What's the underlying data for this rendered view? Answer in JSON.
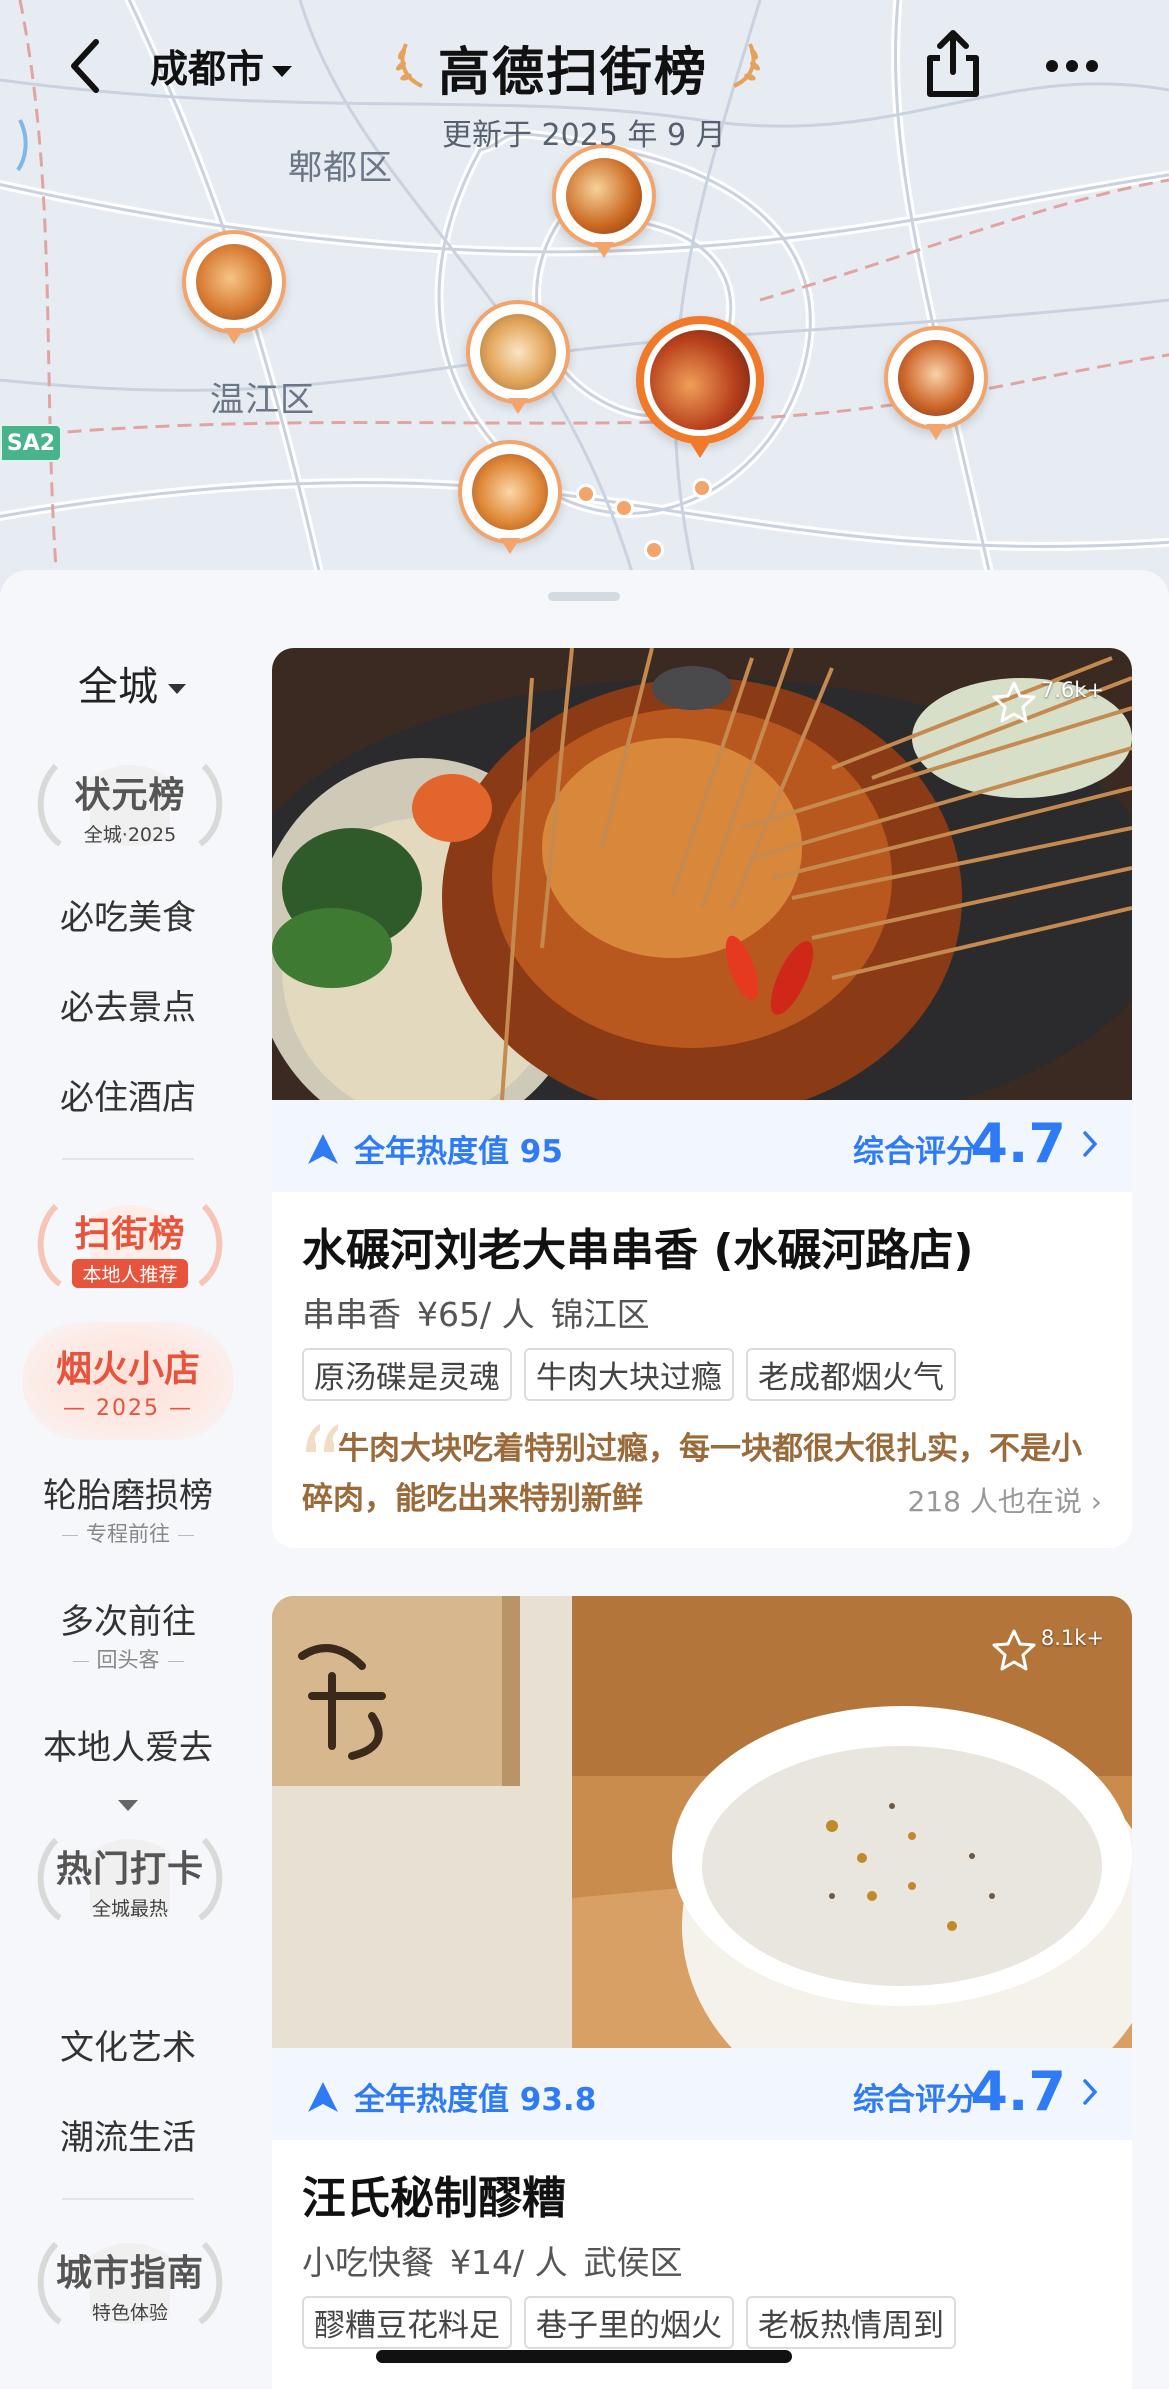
{
  "header": {
    "city": "成都市",
    "brand_title": "高德扫街榜",
    "updated": "更新于 2025 年 9 月"
  },
  "map": {
    "districts": [
      "郫都区",
      "温江区"
    ],
    "road_badge": "SA2"
  },
  "sidebar": {
    "scope": "全城",
    "badge_top": {
      "title": "状元榜",
      "sub": "全城·2025"
    },
    "group1": [
      "必吃美食",
      "必去景点",
      "必住酒店"
    ],
    "badge_street": {
      "title": "扫街榜",
      "sub": "本地人推荐"
    },
    "active": {
      "title": "烟火小店",
      "sub": "— 2025 —"
    },
    "items2": [
      {
        "label": "轮胎磨损榜",
        "sub": "专程前往"
      },
      {
        "label": "多次前往",
        "sub": "回头客"
      },
      {
        "label": "本地人爱去"
      }
    ],
    "badge_hot": {
      "title": "热门打卡",
      "sub": "全城最热"
    },
    "group3": [
      "文化艺术",
      "潮流生活"
    ],
    "badge_guide": {
      "title": "城市指南",
      "sub": "特色体验"
    }
  },
  "cards": [
    {
      "fav_count": "7.6k+",
      "heat": "全年热度值 95",
      "score_label": "综合评分",
      "score": "4.7",
      "name": "水碾河刘老大串串香 (水碾河路店)",
      "category": "串串香",
      "price": "¥65/ 人",
      "area": "锦江区",
      "tags": [
        "原汤碟是灵魂",
        "牛肉大块过瘾",
        "老成都烟火气"
      ],
      "quote": "牛肉大块吃着特别过瘾，每一块都很大很扎实，不是小碎肉，能吃出来特别新鲜",
      "talk": "218 人也在说"
    },
    {
      "fav_count": "8.1k+",
      "heat": "全年热度值 93.8",
      "score_label": "综合评分",
      "score": "4.7",
      "name": "汪氏秘制醪糟",
      "category": "小吃快餐",
      "price": "¥14/ 人",
      "area": "武侯区",
      "tags": [
        "醪糟豆花料足",
        "巷子里的烟火",
        "老板热情周到"
      ]
    }
  ],
  "colors": {
    "accent_blue": "#2f7bf5",
    "accent_red": "#e8533b",
    "pin_orange": "#f07a2a"
  }
}
